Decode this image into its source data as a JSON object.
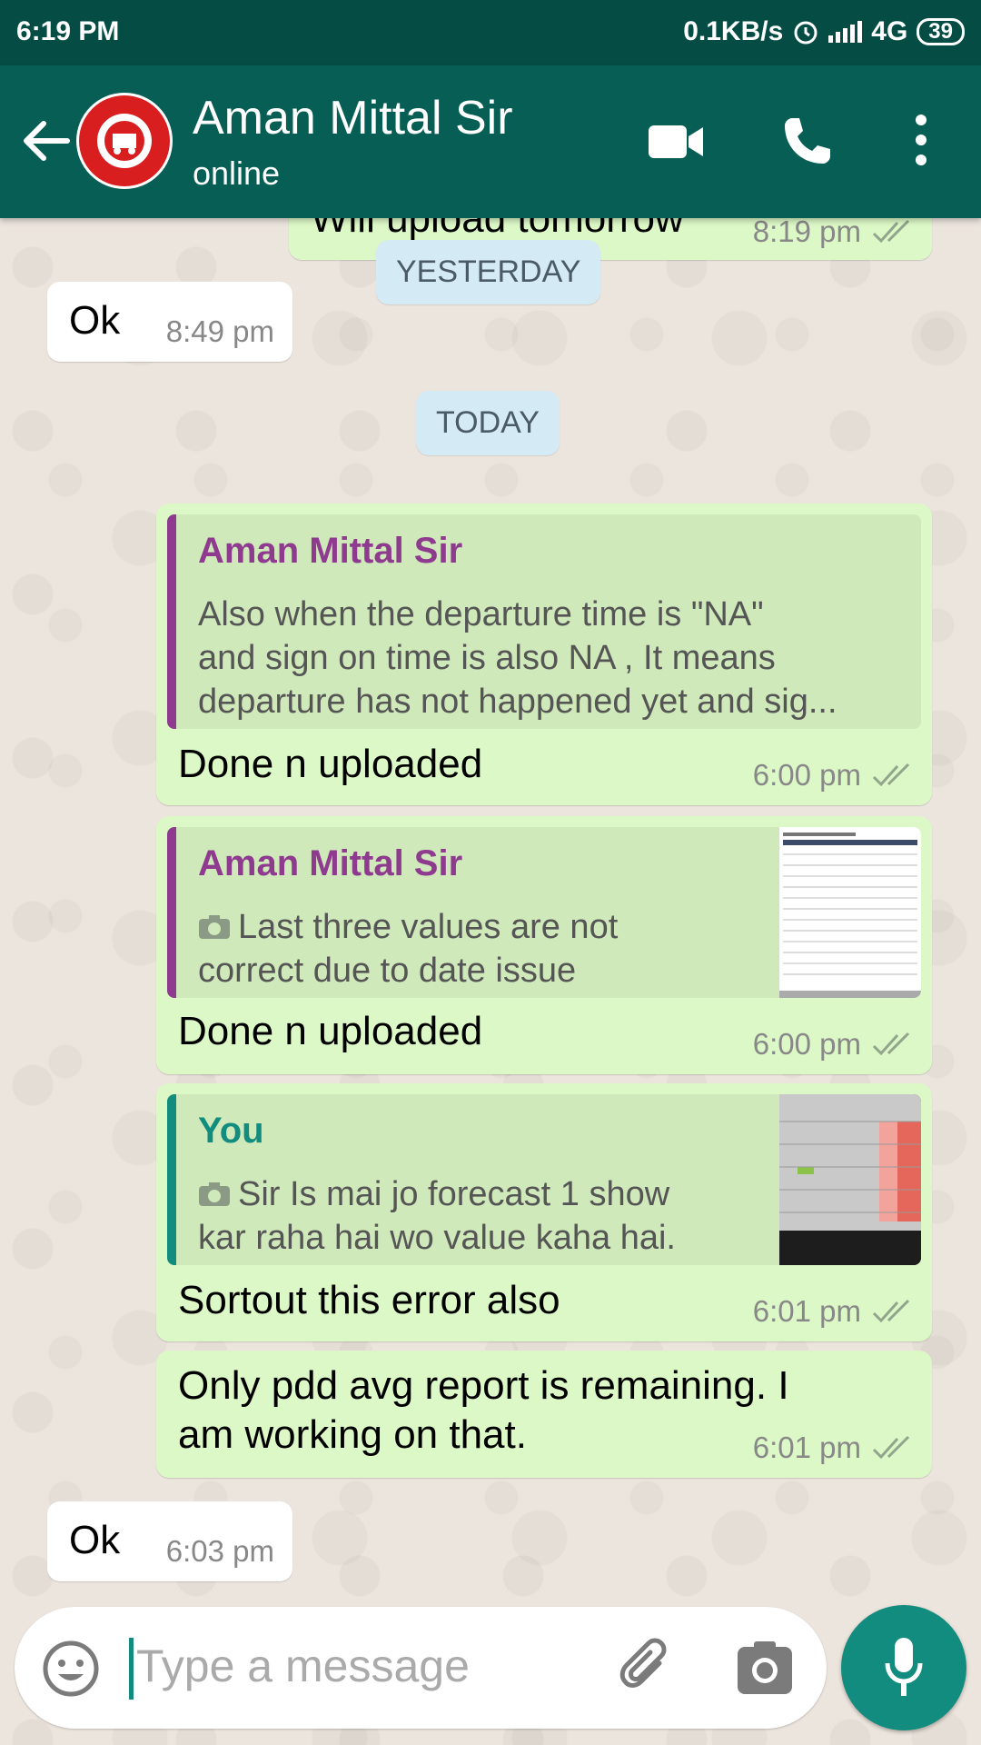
{
  "status_bar": {
    "time": "6:19 PM",
    "network_speed": "0.1KB/s",
    "network_type": "4G",
    "battery": "39"
  },
  "header": {
    "contact_name": "Aman Mittal Sir",
    "status": "online",
    "avatar_icon": "indian-railways-logo"
  },
  "partial_message": {
    "text": "Will upload tomorrow",
    "time": "8:19 pm"
  },
  "date_chips": {
    "yesterday": "YESTERDAY",
    "today": "TODAY"
  },
  "messages": [
    {
      "direction": "in",
      "text": "Ok",
      "time": "8:49 pm"
    },
    {
      "direction": "out",
      "quote_author": "Aman Mittal Sir",
      "quote_lines": [
        "Also when the departure time is \"NA\"",
        "and sign on time is also NA , It means",
        "departure has not happened yet and sig..."
      ],
      "text": "Done n uploaded",
      "time": "6:00 pm"
    },
    {
      "direction": "out",
      "quote_author": "Aman Mittal Sir",
      "quote_lines": [
        "Last three values are not",
        "correct due to date issue"
      ],
      "text": "Done n uploaded",
      "time": "6:00 pm"
    },
    {
      "direction": "out",
      "quote_author": "You",
      "quote_lines": [
        "Sir Is mai jo forecast 1 show",
        "kar raha hai wo value kaha hai."
      ],
      "text": "Sortout this error also",
      "time": "6:01 pm"
    },
    {
      "direction": "out",
      "text_lines": [
        "Only pdd avg report is remaining. I",
        "am working on that."
      ],
      "time": "6:01 pm"
    },
    {
      "direction": "in",
      "text": "Ok",
      "time": "6:03 pm"
    }
  ],
  "input": {
    "placeholder": "Type a message"
  },
  "colors": {
    "header": "#075e54",
    "status_bar": "#054d44",
    "outgoing": "#dcf8c6",
    "quote_other": "#8e3a8e",
    "quote_you": "#128c7e",
    "accent": "#128c7e"
  }
}
